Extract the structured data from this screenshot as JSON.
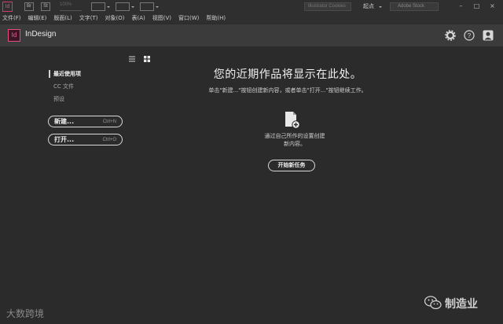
{
  "app_bar": {
    "logo": "Id",
    "tools": [
      "Br",
      "St"
    ],
    "zoom": "100%",
    "search_placeholder": "Illustrator Cookies",
    "workspace": "起点",
    "stock_search": "Adobe Stock",
    "window_controls": [
      "–",
      "□",
      "×"
    ]
  },
  "menu": {
    "items": [
      "文件(F)",
      "编辑(E)",
      "版面(L)",
      "文字(T)",
      "对象(O)",
      "表(A)",
      "视图(V)",
      "窗口(W)",
      "帮助(H)"
    ]
  },
  "home": {
    "logo": "Id",
    "app_name": "InDesign",
    "icons": [
      "gear-icon",
      "help-icon",
      "user-icon"
    ]
  },
  "sidebar": {
    "nav": [
      "最近使用项",
      "CC 文件",
      "预设"
    ],
    "buttons": [
      {
        "label": "新建...",
        "shortcut": "Ctrl+N"
      },
      {
        "label": "打开...",
        "shortcut": "Ctrl+O"
      }
    ]
  },
  "main": {
    "title": "您的近期作品将显示在此处。",
    "subtitle": "单击\"新建...\"按钮创建新内容，或者单击\"打开...\"按钮继续工作。",
    "empty_text_line1": "通过自己所作的设置创建",
    "empty_text_line2": "新内容。",
    "start_button": "开始新任务"
  },
  "watermarks": {
    "left": "大数跨境",
    "right": "制造业"
  },
  "colors": {
    "accent": "#ff5d93",
    "background": "#2b2b2b",
    "header": "#3b3b3b"
  }
}
